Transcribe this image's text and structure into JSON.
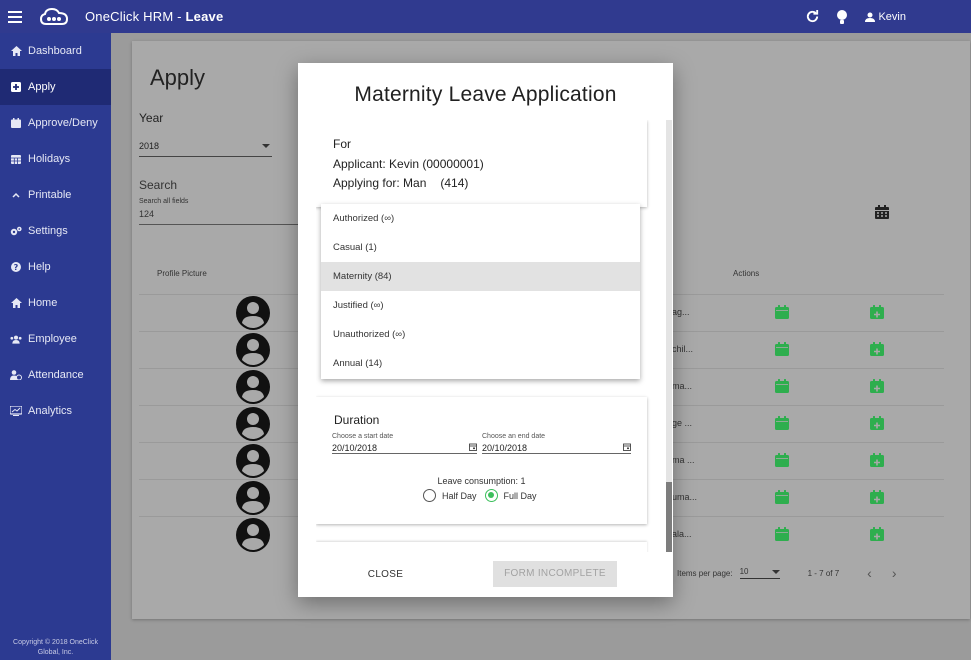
{
  "header": {
    "app_name": "OneClick HRM - ",
    "section": "Leave",
    "user": "Kevin"
  },
  "sidebar": {
    "items": [
      {
        "label": "Dashboard",
        "icon": "dashboard-icon"
      },
      {
        "label": "Apply",
        "icon": "plus-box-icon"
      },
      {
        "label": "Approve/Deny",
        "icon": "calendar-icon"
      },
      {
        "label": "Holidays",
        "icon": "calendar-grid-icon"
      },
      {
        "label": "Printable",
        "icon": "chevron-up-icon"
      },
      {
        "label": "Settings",
        "icon": "gears-icon"
      },
      {
        "label": "Help",
        "icon": "help-icon"
      },
      {
        "label": "Home",
        "icon": "home-icon"
      },
      {
        "label": "Employee",
        "icon": "users-icon"
      },
      {
        "label": "Attendance",
        "icon": "user-clock-icon"
      },
      {
        "label": "Analytics",
        "icon": "analytics-icon"
      }
    ],
    "active_index": 1,
    "copyright_line1": "Copyright © 2018 OneClick",
    "copyright_line2": "Global, Inc."
  },
  "page": {
    "title": "Apply",
    "year_label": "Year",
    "year_value": "2018",
    "search_label": "Search",
    "search_hint": "Search all fields",
    "search_value": "124",
    "col_profile": "Profile Picture",
    "col_actions": "Actions",
    "row_texts": [
      "ag...",
      "chil...",
      "ma...",
      "ge ...",
      "ma ...",
      "uma...",
      "ala..."
    ],
    "items_per_page_label": "Items per page:",
    "items_per_page_value": "10",
    "range": "1 - 7 of 7"
  },
  "colors": {
    "action_green": "#2eae4e",
    "sidebar": "#2c3a91",
    "topbar": "#303a8f"
  },
  "modal": {
    "title": "Maternity Leave Application",
    "for_label": "For",
    "applicant": "Applicant: Kevin (00000001)",
    "applying_for": "Applying for: Man",
    "applying_num": "(414)",
    "leave_types": [
      "Authorized (∞)",
      "Casual (1)",
      "Maternity (84)",
      "Justified (∞)",
      "Unauthorized (∞)",
      "Annual (14)"
    ],
    "selected_index": 2,
    "duration_label": "Duration",
    "start_label": "Choose a start date",
    "start_value": "20/10/2018",
    "end_label": "Choose an end date",
    "end_value": "20/10/2018",
    "consumption": "Leave consumption: 1",
    "half_day": "Half Day",
    "full_day": "Full Day",
    "close_label": "CLOSE",
    "submit_label": "FORM INCOMPLETE"
  }
}
